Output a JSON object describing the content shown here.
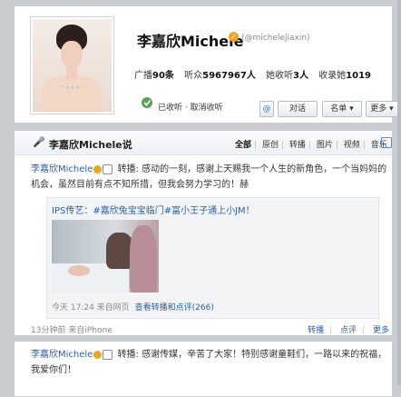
{
  "profile": {
    "name": "李嘉欣Michele",
    "handle": "(@michelejiaxin)",
    "stats": {
      "broadcast_label": "广播",
      "broadcast_value": "90条",
      "listeners_label": "听众",
      "listeners_value": "5967967人",
      "following_label": "她收听",
      "following_value": "3人",
      "favorites_label": "收录她",
      "favorites_value": "1019"
    },
    "follow_status": "已收听 · 取消收听",
    "buttons": {
      "at": "@",
      "chat": "对话",
      "list": "名单 ▾",
      "more": "更多 ▾"
    }
  },
  "feed": {
    "title": "李嘉欣Michele说",
    "filters": [
      "全部",
      "原创",
      "转播",
      "图片",
      "视频",
      "音乐"
    ],
    "post1": {
      "author": "李嘉欣Michele",
      "action": "转播:",
      "text": "感动的一刻，感谢上天赐我一个人生的新角色，一个当妈妈的机会，虽然目前有点不知所措，但我会努力学习的！赫",
      "repost": {
        "text": "IPS传艺：#嘉欣兔宝宝临门#富小王子通上小JM！",
        "time": "今天 17:24 来自网页",
        "link": "查看转播和点评(266)"
      },
      "footer_time": "13分钟前 来自iPhone",
      "actions": [
        "转播",
        "点评",
        "更多"
      ]
    },
    "post2": {
      "author": "李嘉欣Michele",
      "action": "转播:",
      "text": "感谢传媒，辛苦了大家！特别感谢童鞋们，一路以来的祝福，我爱你们！"
    }
  },
  "colors": {
    "link": "#2a5fa5",
    "verify": "#f0a51a"
  }
}
